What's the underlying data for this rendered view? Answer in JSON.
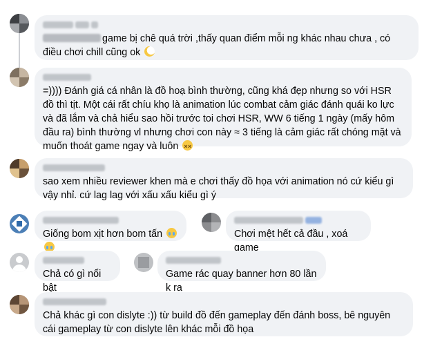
{
  "comments": [
    {
      "text_before_blur": "",
      "text": "game bị chê quá trời ,thấy quan điểm mỗi ng khác nhau chưa , có điều chơi chill cũng ok",
      "emoji": "moon-face-icon"
    },
    {
      "text": "=)))) Đánh giá cá nhân là đồ hoạ bình thường, cũng khá đẹp nhưng so với HSR đồ thì tịt. Một cái rất chíu khọ là animation lúc combat cảm giác đánh quái ko lực và đã lắm và chả hiểu sao hồi trước toi chơi HSR, WW 6 tiếng 1 ngày (mấy hôm đầu ra) bình thường vl nhưng chơi con này ≈ 3 tiếng là cảm giác rất chóng mặt và muốn thoát game ngay và luôn",
      "emoji": "dizzy-face-icon"
    },
    {
      "text": "sao xem nhiều reviewer khen mà e chơi thấy đồ họa với animation nó cứ kiểu gì vậy nhỉ. cứ lag lag với xấu xấu kiểu gì ý"
    },
    {
      "text": "Giống bom xịt hơn bom tấn",
      "emoji": "crying-face-icon"
    },
    {
      "text": "Chơi mệt hết cả đầu , xoá game"
    },
    {
      "text": "Chả có gì nổi bật"
    },
    {
      "text": "Game rác quay banner hơn 80 lần k ra"
    },
    {
      "text": "Chả khác gì con dislyte :)) từ build đồ đến gameplay đến đánh boss, bê nguyên cái gameplay từ con dislyte lên khác mỗi đồ họa"
    }
  ],
  "colors": {
    "bubble": "#f0f2f5",
    "text": "#050505",
    "thread_line": "#ced0d4"
  }
}
